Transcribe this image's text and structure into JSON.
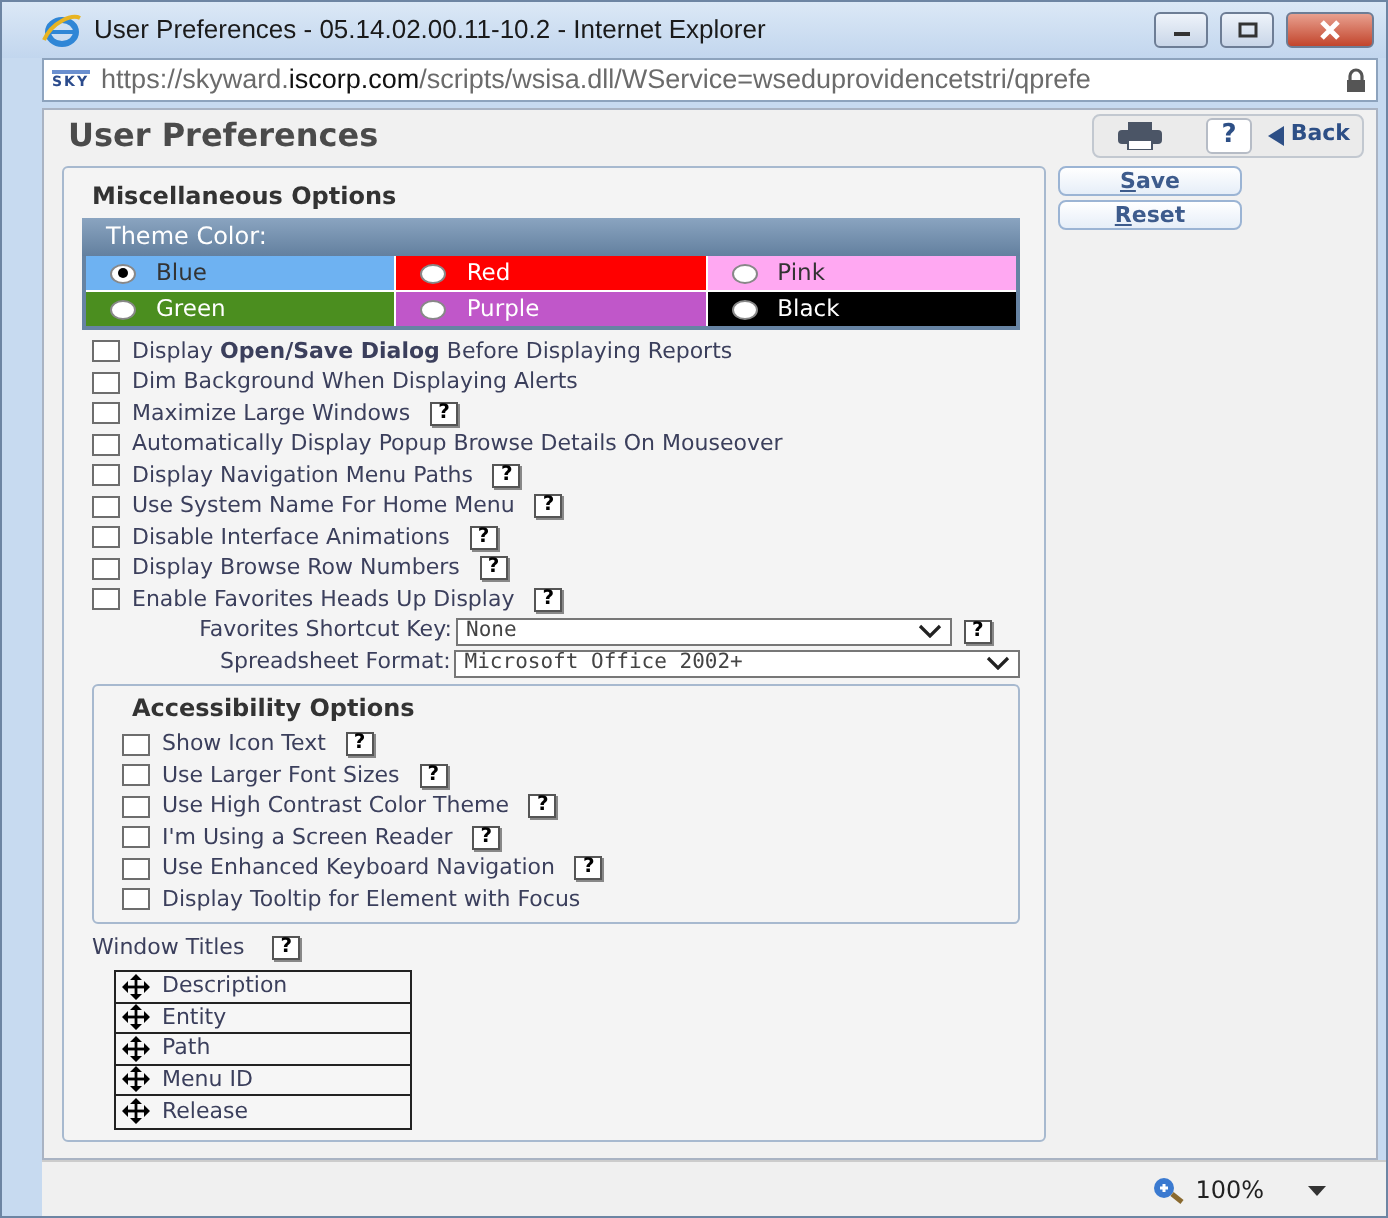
{
  "window": {
    "title": "User Preferences - 05.14.02.00.11-10.2 - Internet Explorer"
  },
  "address_bar": {
    "logo_text": "SKY",
    "url": [
      {
        "text": "https://skyward.",
        "emphasis": false
      },
      {
        "text": "iscorp.com",
        "emphasis": true
      },
      {
        "text": "/scripts/wsisa.dll/WService=wseduprovidencetstri/qprefe",
        "emphasis": false
      }
    ]
  },
  "page": {
    "title": "User Preferences",
    "toolbar": {
      "help": "?",
      "back": "Back"
    },
    "actions": [
      {
        "label": "Save"
      },
      {
        "label": "Reset"
      }
    ]
  },
  "misc": {
    "title": "Miscellaneous Options",
    "theme_title": "Theme Color:",
    "themes": [
      {
        "label": "Blue",
        "color": "#6eb2f2",
        "selected": true
      },
      {
        "label": "Red",
        "color": "#ff0000",
        "selected": false
      },
      {
        "label": "Pink",
        "color": "#ffa8f2",
        "selected": false
      },
      {
        "label": "Green",
        "color": "#4b8e1f",
        "selected": false
      },
      {
        "label": "Purple",
        "color": "#c057c9",
        "selected": false
      },
      {
        "label": "Black",
        "color": "#000000",
        "selected": false
      }
    ],
    "options": [
      {
        "label": "Display **Open/Save Dialog** Before Displaying Reports",
        "checked": false
      },
      {
        "label": "Dim Background When Displaying Alerts",
        "checked": false
      },
      {
        "label": "Maximize Large Windows",
        "checked": false,
        "help": "?"
      },
      {
        "label": "Automatically Display Popup Browse Details On Mouseover",
        "checked": false
      },
      {
        "label": "Display Navigation Menu Paths",
        "checked": false,
        "help": "?"
      },
      {
        "label": "Use System Name For Home Menu",
        "checked": false,
        "help": "?"
      },
      {
        "label": "Disable Interface Animations",
        "checked": false,
        "help": "?"
      },
      {
        "label": "Display Browse Row Numbers",
        "checked": false,
        "help": "?"
      },
      {
        "label": "Enable Favorites Heads Up Display",
        "checked": false,
        "help": "?"
      }
    ],
    "selects": [
      {
        "label": "Favorites Shortcut Key:",
        "value": "None",
        "help": "?"
      },
      {
        "label": "Spreadsheet Format:",
        "value": "Microsoft Office 2002+"
      }
    ]
  },
  "accessibility": {
    "title": "Accessibility Options",
    "options": [
      {
        "label": "Show Icon Text",
        "checked": false,
        "help": "?"
      },
      {
        "label": "Use Larger Font Sizes",
        "checked": false,
        "help": "?"
      },
      {
        "label": "Use High Contrast Color Theme",
        "checked": false,
        "help": "?"
      },
      {
        "label": "I'm Using a Screen Reader",
        "checked": false,
        "help": "?"
      },
      {
        "label": "Use Enhanced Keyboard Navigation",
        "checked": false,
        "help": "?"
      },
      {
        "label": "Display Tooltip for Element with Focus",
        "checked": false
      }
    ]
  },
  "window_titles": {
    "label": "Window Titles",
    "help": "?",
    "items": [
      "Description",
      "Entity",
      "Path",
      "Menu ID",
      "Release"
    ]
  },
  "status_bar": {
    "zoom": "100%"
  }
}
